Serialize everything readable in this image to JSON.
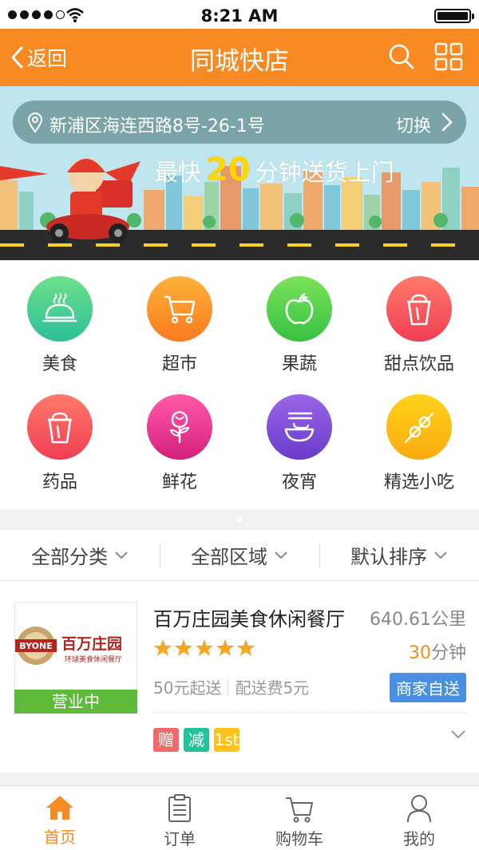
{
  "status_bar": {
    "time": "8:21 AM"
  },
  "header": {
    "back_label": "返回",
    "title": "同城快店"
  },
  "banner": {
    "address": "新浦区海连西路8号-26-1号",
    "switch_label": "切换",
    "slogan_prefix": "最快",
    "slogan_number": "20",
    "slogan_suffix": "分钟送货上门"
  },
  "categories": [
    {
      "label": "美食",
      "icon": "cloche-icon",
      "color_top": "#6ee08a",
      "color_bottom": "#2cbf9a"
    },
    {
      "label": "超市",
      "icon": "cart-icon",
      "color_top": "#ffb23a",
      "color_bottom": "#f77a20"
    },
    {
      "label": "果蔬",
      "icon": "apple-icon",
      "color_top": "#7be35a",
      "color_bottom": "#36c142"
    },
    {
      "label": "甜点饮品",
      "icon": "drink-cup-icon",
      "color_top": "#ff7a6a",
      "color_bottom": "#f03e54"
    },
    {
      "label": "药品",
      "icon": "medicine-cup-icon",
      "color_top": "#ff7a6a",
      "color_bottom": "#f03e54"
    },
    {
      "label": "鲜花",
      "icon": "rose-icon",
      "color_top": "#ff5aa8",
      "color_bottom": "#d4207c"
    },
    {
      "label": "夜宵",
      "icon": "noodle-bowl-icon",
      "color_top": "#9a66e8",
      "color_bottom": "#6a3cc8"
    },
    {
      "label": "精选小吃",
      "icon": "skewer-icon",
      "color_top": "#ffd21a",
      "color_bottom": "#f9ab0e"
    }
  ],
  "filters": [
    "全部分类",
    "全部区域",
    "默认排序"
  ],
  "shop": {
    "name": "百万庄园美食休闲餐厅",
    "distance": "640.61公里",
    "rating": 5,
    "delivery_time_value": "30",
    "delivery_time_unit": "分钟",
    "min_order": "50元起送",
    "delivery_fee": "配送费5元",
    "self_delivery_badge": "商家自送",
    "status": "营业中",
    "logo_brand": "BYONE",
    "logo_name": "百万庄园",
    "logo_subtitle": "环球美食休闲餐厅",
    "tags": [
      {
        "text": "赠",
        "color": "#f06a6a"
      },
      {
        "text": "减",
        "color": "#22c29a"
      },
      {
        "text": "1st",
        "color": "#ffc21a"
      }
    ]
  },
  "tabs": [
    {
      "label": "首页",
      "icon": "home-icon",
      "active": true
    },
    {
      "label": "订单",
      "icon": "order-icon",
      "active": false
    },
    {
      "label": "购物车",
      "icon": "cart-icon",
      "active": false
    },
    {
      "label": "我的",
      "icon": "user-icon",
      "active": false
    }
  ],
  "colors": {
    "brand": "#f88a24",
    "status_open": "#5dba3a",
    "badge_blue": "#4a90e2",
    "star": "#f5a623"
  }
}
